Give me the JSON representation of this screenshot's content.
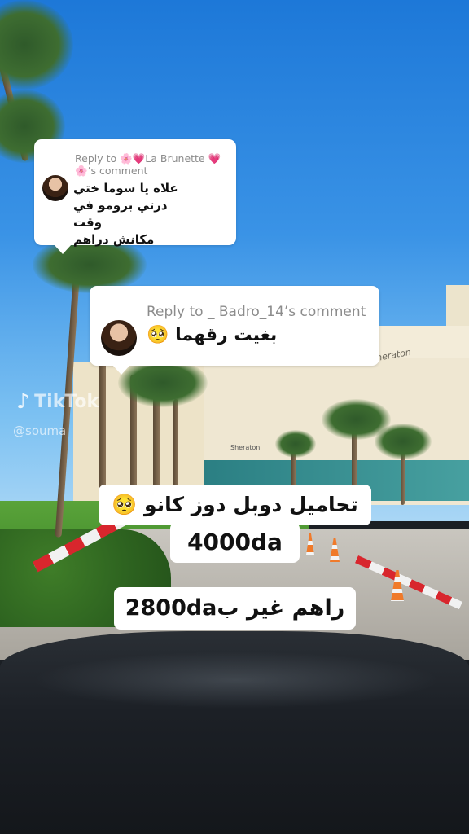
{
  "watermark": {
    "brand": "TikTok",
    "handle": "@souma"
  },
  "comment_reply_1": {
    "reply_prefix": "Reply to",
    "emoji_before": "🌸💗",
    "name": "La Brunette",
    "emoji_after": "💗",
    "emoji_line2": "🌸",
    "suffix": "’s comment",
    "text_lines": [
      "علاه يا سوما ختي",
      "درتي برومو في وقت",
      "مكانش دراهم"
    ]
  },
  "comment_reply_2": {
    "reply_line": "Reply to _ Badro_14’s comment",
    "text": "بغيت رقهما",
    "emoji": "🥺"
  },
  "captions": {
    "line1": "تحاميل دوبل دوز كانو 🥺",
    "line2": "4000da",
    "line3": "راهم غير ب2800da"
  },
  "background_labels": {
    "hotel_sign": "Sheraton",
    "hotel_sign_ground": "Sheraton"
  },
  "colors": {
    "card_bg": "#ffffff",
    "reply_text": "#8c8c8c",
    "sky": "#2a86de"
  }
}
